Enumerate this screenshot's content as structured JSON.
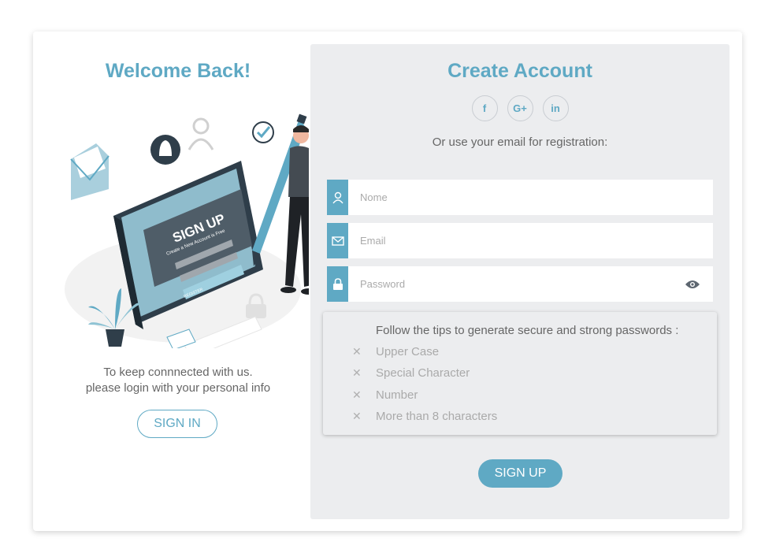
{
  "left_panel": {
    "title": "Welcome Back!",
    "illustration": {
      "heading": "SIGN UP",
      "subheading": "Create a New Account is Free",
      "email_field": "Enter your E-mail",
      "password_field": "Enter your Password",
      "button": "REGISTER"
    },
    "message_line1": "To keep connnected with us.",
    "message_line2": "please login with your personal info",
    "sign_in_label": "SIGN IN"
  },
  "right_panel": {
    "title": "Create Account",
    "social": [
      {
        "icon": "facebook-icon",
        "label": "f"
      },
      {
        "icon": "google-plus-icon",
        "label": "G+"
      },
      {
        "icon": "linkedin-icon",
        "label": "in"
      }
    ],
    "subtitle": "Or use your email for registration:",
    "fields": {
      "name_placeholder": "Nome",
      "email_placeholder": "Email",
      "password_placeholder": "Password"
    },
    "tips": {
      "heading": "Follow the tips to generate secure and strong passwords :",
      "items": [
        "Upper Case",
        "Special Character",
        "Number",
        "More than 8 characters"
      ]
    },
    "sign_up_label": "SIGN UP"
  },
  "colors": {
    "accent": "#5fa9c4",
    "panel_bg": "#ecedef"
  }
}
